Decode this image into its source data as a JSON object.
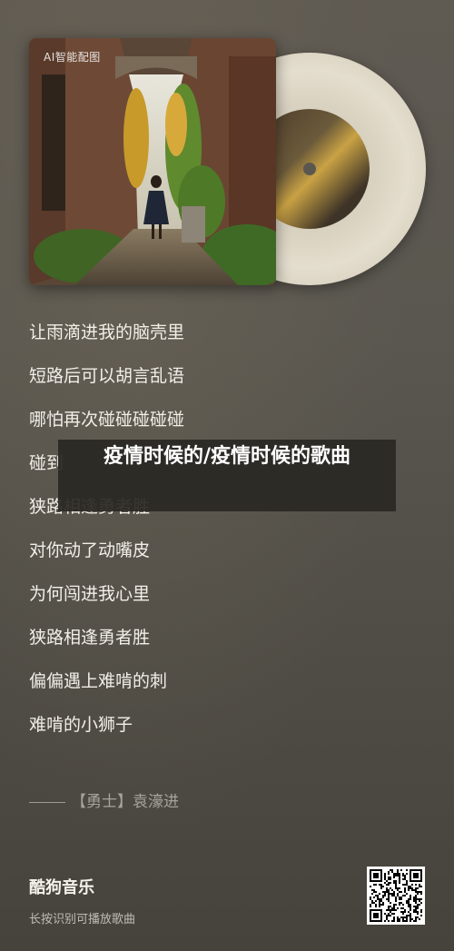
{
  "cover": {
    "watermark": "AI智能配图"
  },
  "lyrics": [
    "让雨滴进我的脑壳里",
    "短路后可以胡言乱语",
    "哪怕再次碰碰碰碰碰",
    "碰到",
    "狭路相逢勇者胜",
    "对你动了动嘴皮",
    "为何闯进我心里",
    "狭路相逢勇者胜",
    "偏偏遇上难啃的刺",
    "难啃的小狮子"
  ],
  "credit": "【勇士】袁濠进",
  "overlay_title": "疫情时候的/疫情时候的歌曲",
  "footer": {
    "brand": "酷狗音乐",
    "subtitle": "长按识别可播放歌曲"
  },
  "icons": {
    "qr": "qr-code-icon"
  }
}
